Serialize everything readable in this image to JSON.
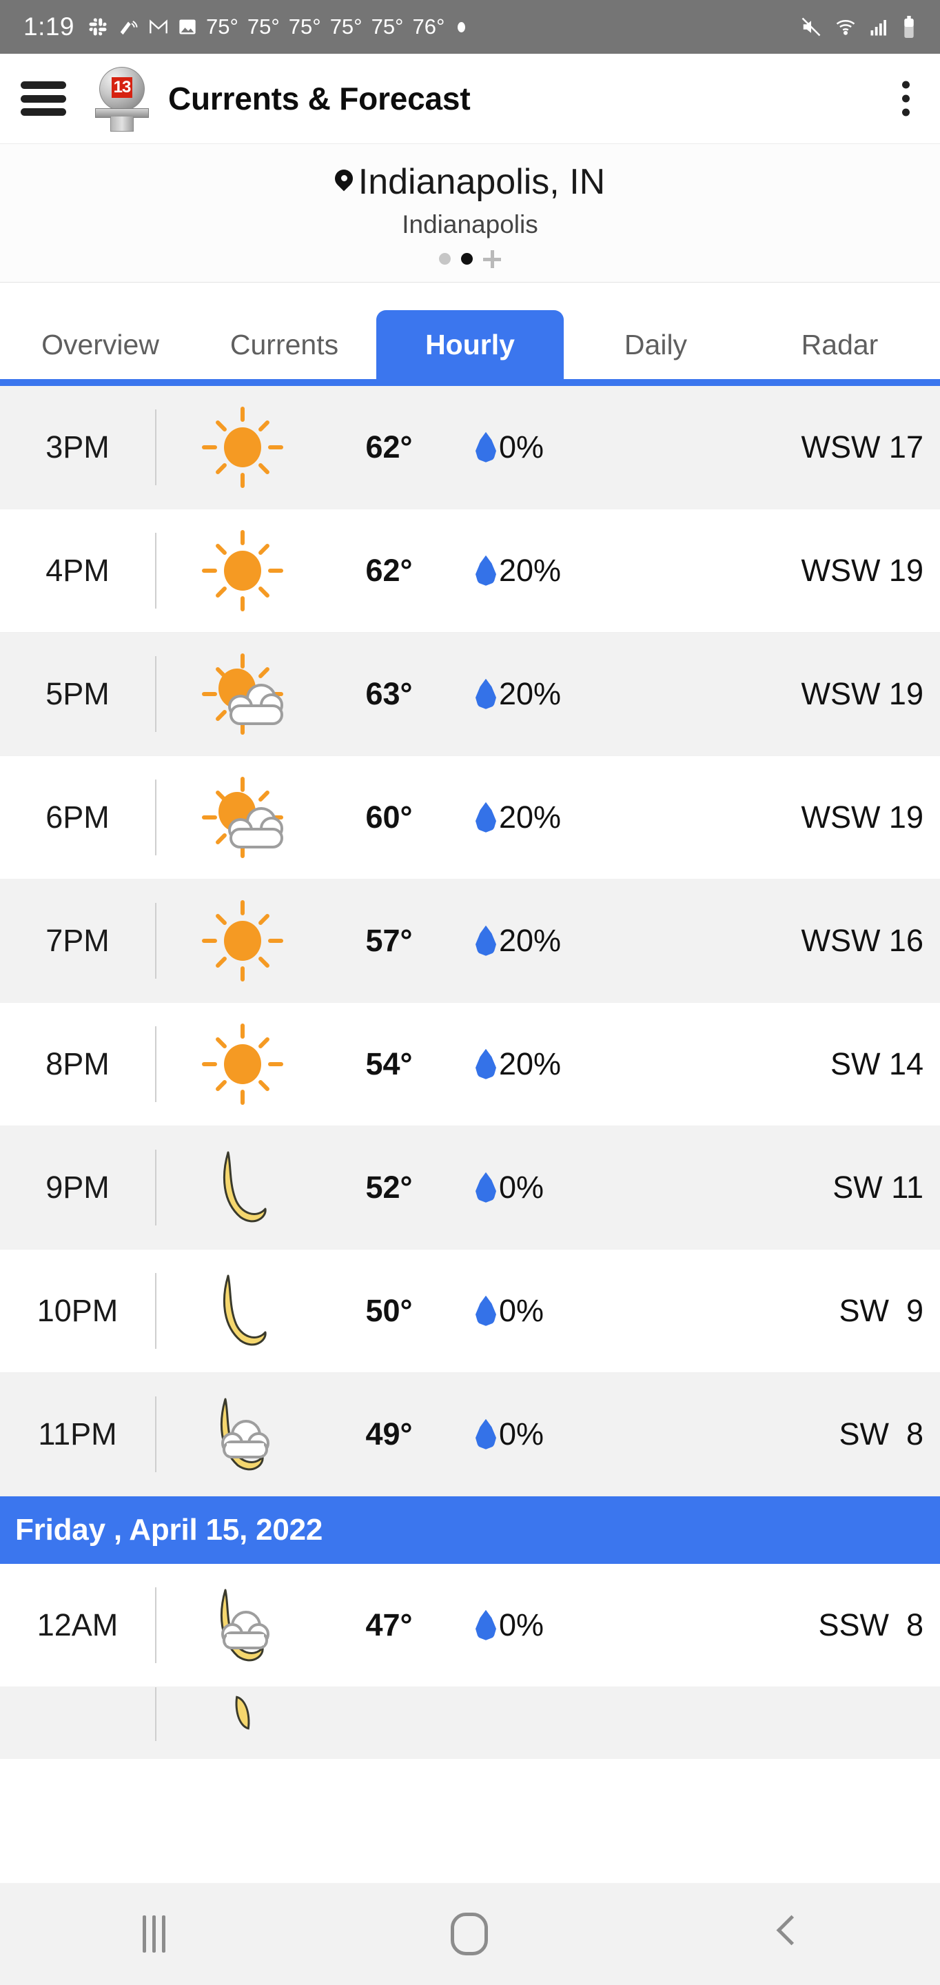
{
  "status_bar": {
    "time": "1:19",
    "icons": [
      "slack-icon",
      "do-not-disturb-vibrate-icon",
      "gmail-icon",
      "photo-icon"
    ],
    "temps": [
      "75°",
      "75°",
      "75°",
      "75°",
      "75°",
      "76°"
    ],
    "right_icons": [
      "mute-icon",
      "wifi-icon",
      "signal-icon",
      "battery-icon"
    ]
  },
  "app_bar": {
    "menu_icon": "hamburger-menu-icon",
    "logo": "channel-13-water-tower-logo",
    "logo_badge": "13",
    "title": "Currents & Forecast",
    "overflow_icon": "kebab-menu-icon"
  },
  "location": {
    "pin_icon": "location-pin-icon",
    "city_state": "Indianapolis, IN",
    "sub": "Indianapolis",
    "pager": {
      "count": 2,
      "active_index": 1,
      "add_label": "add-location-icon"
    }
  },
  "tabs": {
    "items": [
      "Overview",
      "Currents",
      "Hourly",
      "Daily",
      "Radar"
    ],
    "active": "Hourly",
    "accent": "#3B76EE"
  },
  "colors": {
    "accent_blue": "#3B76EE",
    "droplet_blue": "#3472E8",
    "sun_orange": "#F59A23",
    "moon_yellow": "#F5D76E",
    "row_alt": "#f2f2f2",
    "status_bar": "#757575"
  },
  "hourly": {
    "columns": [
      "time",
      "condition",
      "temperature",
      "precipitation",
      "wind"
    ],
    "rows": [
      {
        "time": "3PM",
        "icon": "sunny-icon",
        "temp": "62°",
        "pop": "0%",
        "wind": "WSW 17"
      },
      {
        "time": "4PM",
        "icon": "sunny-icon",
        "temp": "62°",
        "pop": "20%",
        "wind": "WSW 19"
      },
      {
        "time": "5PM",
        "icon": "partly-cloudy-day-icon",
        "temp": "63°",
        "pop": "20%",
        "wind": "WSW 19"
      },
      {
        "time": "6PM",
        "icon": "partly-cloudy-day-icon",
        "temp": "60°",
        "pop": "20%",
        "wind": "WSW 19"
      },
      {
        "time": "7PM",
        "icon": "sunny-icon",
        "temp": "57°",
        "pop": "20%",
        "wind": "WSW 16"
      },
      {
        "time": "8PM",
        "icon": "sunny-icon",
        "temp": "54°",
        "pop": "20%",
        "wind": "SW 14"
      },
      {
        "time": "9PM",
        "icon": "clear-night-icon",
        "temp": "52°",
        "pop": "0%",
        "wind": "SW 11"
      },
      {
        "time": "10PM",
        "icon": "clear-night-icon",
        "temp": "50°",
        "pop": "0%",
        "wind": "SW  9"
      },
      {
        "time": "11PM",
        "icon": "partly-cloudy-night-icon",
        "temp": "49°",
        "pop": "0%",
        "wind": "SW  8"
      }
    ],
    "date_divider": "Friday , April 15, 2022",
    "rows_after": [
      {
        "time": "12AM",
        "icon": "partly-cloudy-night-icon",
        "temp": "47°",
        "pop": "0%",
        "wind": "SSW  8"
      }
    ],
    "partial_row": {
      "icon": "clear-night-icon"
    }
  },
  "nav_bar": {
    "recent_icon": "recent-apps-icon",
    "home_icon": "home-icon",
    "back_icon": "back-icon"
  }
}
